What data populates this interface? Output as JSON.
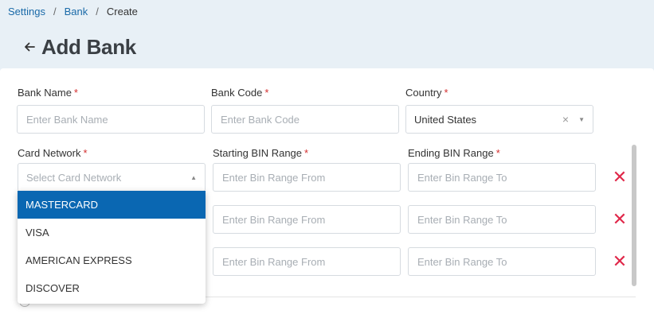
{
  "breadcrumb": {
    "items": [
      "Settings",
      "Bank"
    ],
    "separator": "/",
    "current": "Create"
  },
  "page": {
    "back_icon": "arrow-left-icon",
    "title": "Add Bank"
  },
  "form": {
    "bank_name": {
      "label": "Bank Name",
      "required": "*",
      "placeholder": "Enter Bank Name",
      "value": ""
    },
    "bank_code": {
      "label": "Bank Code",
      "required": "*",
      "placeholder": "Enter Bank Code",
      "value": ""
    },
    "country": {
      "label": "Country",
      "required": "*",
      "value": "United States",
      "clear": "×",
      "caret": "▼"
    },
    "card_network": {
      "label": "Card Network",
      "required": "*",
      "placeholder": "Select Card Network",
      "caret": "▲"
    },
    "starting_bin": {
      "label": "Starting BIN Range",
      "required": "*",
      "placeholder": "Enter Bin Range From"
    },
    "ending_bin": {
      "label": "Ending BIN Range",
      "required": "*",
      "placeholder": "Enter Bin Range To"
    },
    "delete_icon": "✕"
  },
  "dropdown": {
    "options": [
      "MASTERCARD",
      "VISA",
      "AMERICAN EXPRESS",
      "DISCOVER"
    ],
    "highlighted": "MASTERCARD"
  },
  "colors": {
    "accent": "#0a67b2",
    "link": "#1a6aa8",
    "required": "#d32f2f",
    "delete": "#e0284a",
    "header_bg": "#e8f0f6"
  }
}
